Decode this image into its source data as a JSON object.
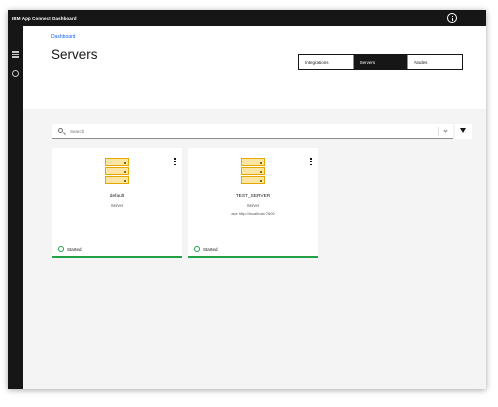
{
  "app": {
    "title": "IBM App Connect Dashboard"
  },
  "header": {
    "breadcrumb": "Dashboard",
    "title": "Servers",
    "tabs": [
      {
        "label": "Integrations",
        "active": false
      },
      {
        "label": "Servers",
        "active": true
      },
      {
        "label": "Nodes",
        "active": false
      }
    ]
  },
  "search": {
    "placeholder": "Search"
  },
  "cards": [
    {
      "name": "default",
      "type": "Server",
      "url": "",
      "status": "Started"
    },
    {
      "name": "TEST_SERVER",
      "type": "Server",
      "url": "ace http://localhost:7600",
      "status": "Started"
    }
  ],
  "colors": {
    "accent": "#0f62fe",
    "status_ok": "#24a148",
    "server_icon": "#f1c21b"
  }
}
